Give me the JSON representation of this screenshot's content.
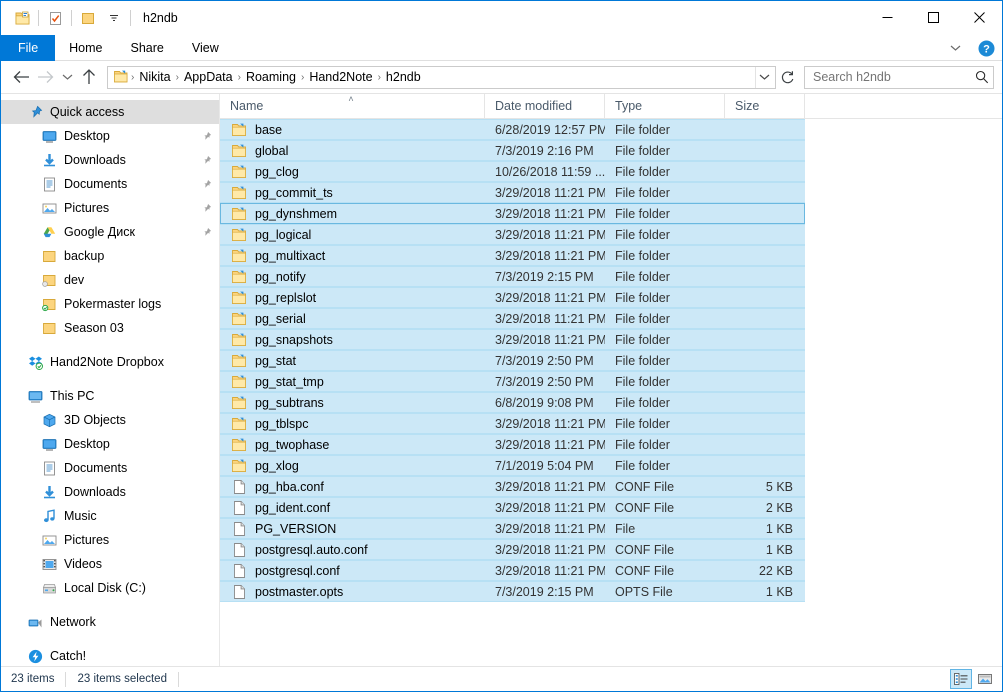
{
  "window": {
    "title": "h2ndb",
    "quick_access_toolbar": [
      {
        "name": "folder-properties-icon",
        "label": "Properties"
      },
      {
        "name": "new-folder-icon",
        "label": "New folder"
      },
      {
        "name": "customize-quick-access-icon",
        "label": "Customize Quick Access Toolbar"
      }
    ],
    "controls": {
      "minimize": "—",
      "maximize": "□",
      "close": "✕"
    }
  },
  "ribbon": {
    "tabs": [
      {
        "label": "File",
        "active": true
      },
      {
        "label": "Home",
        "active": false
      },
      {
        "label": "Share",
        "active": false
      },
      {
        "label": "View",
        "active": false
      }
    ],
    "collapse_label": "Minimize the Ribbon",
    "help_label": "Help"
  },
  "address": {
    "back_label": "Back",
    "forward_label": "Forward",
    "recent_label": "Recent locations",
    "up_label": "Up",
    "refresh_label": "Refresh",
    "dropdown_label": "Previous locations",
    "crumbs": [
      "Nikita",
      "AppData",
      "Roaming",
      "Hand2Note",
      "h2ndb"
    ],
    "separator": "›"
  },
  "search": {
    "placeholder": "Search h2ndb",
    "value": ""
  },
  "sidebar": {
    "groups": [
      {
        "items": [
          {
            "label": "Quick access",
            "icon": "quick-access-pin-icon",
            "indent": 0,
            "selected": true,
            "pinned": false
          },
          {
            "label": "Desktop",
            "icon": "desktop-icon",
            "indent": 1,
            "selected": false,
            "pinned": true
          },
          {
            "label": "Downloads",
            "icon": "downloads-icon",
            "indent": 1,
            "selected": false,
            "pinned": true
          },
          {
            "label": "Documents",
            "icon": "documents-icon",
            "indent": 1,
            "selected": false,
            "pinned": true
          },
          {
            "label": "Pictures",
            "icon": "pictures-icon",
            "indent": 1,
            "selected": false,
            "pinned": true
          },
          {
            "label": "Google Диск",
            "icon": "google-drive-icon",
            "indent": 1,
            "selected": false,
            "pinned": true
          },
          {
            "label": "backup",
            "icon": "folder-icon",
            "indent": 1,
            "selected": false,
            "pinned": false
          },
          {
            "label": "dev",
            "icon": "folder-sync-icon",
            "indent": 1,
            "selected": false,
            "pinned": false
          },
          {
            "label": "Pokermaster logs",
            "icon": "folder-synced-icon",
            "indent": 1,
            "selected": false,
            "pinned": false
          },
          {
            "label": "Season 03",
            "icon": "folder-icon",
            "indent": 1,
            "selected": false,
            "pinned": false
          }
        ]
      },
      {
        "items": [
          {
            "label": "Hand2Note Dropbox",
            "icon": "dropbox-icon",
            "indent": 0,
            "selected": false,
            "pinned": false
          }
        ]
      },
      {
        "items": [
          {
            "label": "This PC",
            "icon": "this-pc-icon",
            "indent": 0,
            "selected": false,
            "pinned": false
          },
          {
            "label": "3D Objects",
            "icon": "3d-objects-icon",
            "indent": 1,
            "selected": false,
            "pinned": false
          },
          {
            "label": "Desktop",
            "icon": "desktop-icon",
            "indent": 1,
            "selected": false,
            "pinned": false
          },
          {
            "label": "Documents",
            "icon": "documents-icon",
            "indent": 1,
            "selected": false,
            "pinned": false
          },
          {
            "label": "Downloads",
            "icon": "downloads-icon",
            "indent": 1,
            "selected": false,
            "pinned": false
          },
          {
            "label": "Music",
            "icon": "music-icon",
            "indent": 1,
            "selected": false,
            "pinned": false
          },
          {
            "label": "Pictures",
            "icon": "pictures-icon",
            "indent": 1,
            "selected": false,
            "pinned": false
          },
          {
            "label": "Videos",
            "icon": "videos-icon",
            "indent": 1,
            "selected": false,
            "pinned": false
          },
          {
            "label": "Local Disk (C:)",
            "icon": "hard-drive-icon",
            "indent": 1,
            "selected": false,
            "pinned": false
          }
        ]
      },
      {
        "items": [
          {
            "label": "Network",
            "icon": "network-icon",
            "indent": 0,
            "selected": false,
            "pinned": false
          }
        ]
      },
      {
        "items": [
          {
            "label": "Catch!",
            "icon": "catch-icon",
            "indent": 0,
            "selected": false,
            "pinned": false
          }
        ]
      }
    ]
  },
  "filelist": {
    "columns": [
      {
        "key": "name",
        "label": "Name",
        "sorted": "asc"
      },
      {
        "key": "date",
        "label": "Date modified",
        "sorted": ""
      },
      {
        "key": "type",
        "label": "Type",
        "sorted": ""
      },
      {
        "key": "size",
        "label": "Size",
        "sorted": ""
      }
    ],
    "sort_caret": "˄",
    "rows": [
      {
        "name": "base",
        "date": "6/28/2019 12:57 PM",
        "type": "File folder",
        "size": "",
        "icon": "folder-icon",
        "selected": true,
        "focus": false
      },
      {
        "name": "global",
        "date": "7/3/2019 2:16 PM",
        "type": "File folder",
        "size": "",
        "icon": "folder-icon",
        "selected": true,
        "focus": false
      },
      {
        "name": "pg_clog",
        "date": "10/26/2018 11:59 ...",
        "type": "File folder",
        "size": "",
        "icon": "folder-icon",
        "selected": true,
        "focus": false
      },
      {
        "name": "pg_commit_ts",
        "date": "3/29/2018 11:21 PM",
        "type": "File folder",
        "size": "",
        "icon": "folder-icon",
        "selected": true,
        "focus": false
      },
      {
        "name": "pg_dynshmem",
        "date": "3/29/2018 11:21 PM",
        "type": "File folder",
        "size": "",
        "icon": "folder-icon",
        "selected": true,
        "focus": true
      },
      {
        "name": "pg_logical",
        "date": "3/29/2018 11:21 PM",
        "type": "File folder",
        "size": "",
        "icon": "folder-icon",
        "selected": true,
        "focus": false
      },
      {
        "name": "pg_multixact",
        "date": "3/29/2018 11:21 PM",
        "type": "File folder",
        "size": "",
        "icon": "folder-icon",
        "selected": true,
        "focus": false
      },
      {
        "name": "pg_notify",
        "date": "7/3/2019 2:15 PM",
        "type": "File folder",
        "size": "",
        "icon": "folder-icon",
        "selected": true,
        "focus": false
      },
      {
        "name": "pg_replslot",
        "date": "3/29/2018 11:21 PM",
        "type": "File folder",
        "size": "",
        "icon": "folder-icon",
        "selected": true,
        "focus": false
      },
      {
        "name": "pg_serial",
        "date": "3/29/2018 11:21 PM",
        "type": "File folder",
        "size": "",
        "icon": "folder-icon",
        "selected": true,
        "focus": false
      },
      {
        "name": "pg_snapshots",
        "date": "3/29/2018 11:21 PM",
        "type": "File folder",
        "size": "",
        "icon": "folder-icon",
        "selected": true,
        "focus": false
      },
      {
        "name": "pg_stat",
        "date": "7/3/2019 2:50 PM",
        "type": "File folder",
        "size": "",
        "icon": "folder-icon",
        "selected": true,
        "focus": false
      },
      {
        "name": "pg_stat_tmp",
        "date": "7/3/2019 2:50 PM",
        "type": "File folder",
        "size": "",
        "icon": "folder-icon",
        "selected": true,
        "focus": false
      },
      {
        "name": "pg_subtrans",
        "date": "6/8/2019 9:08 PM",
        "type": "File folder",
        "size": "",
        "icon": "folder-icon",
        "selected": true,
        "focus": false
      },
      {
        "name": "pg_tblspc",
        "date": "3/29/2018 11:21 PM",
        "type": "File folder",
        "size": "",
        "icon": "folder-icon",
        "selected": true,
        "focus": false
      },
      {
        "name": "pg_twophase",
        "date": "3/29/2018 11:21 PM",
        "type": "File folder",
        "size": "",
        "icon": "folder-icon",
        "selected": true,
        "focus": false
      },
      {
        "name": "pg_xlog",
        "date": "7/1/2019 5:04 PM",
        "type": "File folder",
        "size": "",
        "icon": "folder-icon",
        "selected": true,
        "focus": false
      },
      {
        "name": "pg_hba.conf",
        "date": "3/29/2018 11:21 PM",
        "type": "CONF File",
        "size": "5 KB",
        "icon": "file-icon",
        "selected": true,
        "focus": false
      },
      {
        "name": "pg_ident.conf",
        "date": "3/29/2018 11:21 PM",
        "type": "CONF File",
        "size": "2 KB",
        "icon": "file-icon",
        "selected": true,
        "focus": false
      },
      {
        "name": "PG_VERSION",
        "date": "3/29/2018 11:21 PM",
        "type": "File",
        "size": "1 KB",
        "icon": "file-icon",
        "selected": true,
        "focus": false
      },
      {
        "name": "postgresql.auto.conf",
        "date": "3/29/2018 11:21 PM",
        "type": "CONF File",
        "size": "1 KB",
        "icon": "file-icon",
        "selected": true,
        "focus": false
      },
      {
        "name": "postgresql.conf",
        "date": "3/29/2018 11:21 PM",
        "type": "CONF File",
        "size": "22 KB",
        "icon": "file-icon",
        "selected": true,
        "focus": false
      },
      {
        "name": "postmaster.opts",
        "date": "7/3/2019 2:15 PM",
        "type": "OPTS File",
        "size": "1 KB",
        "icon": "file-icon",
        "selected": true,
        "focus": false
      }
    ]
  },
  "statusbar": {
    "item_count": "23 items",
    "selection_count": "23 items selected",
    "views": [
      {
        "name": "details-view",
        "label": "Details view",
        "active": true
      },
      {
        "name": "large-icons-view",
        "label": "Large icons view",
        "active": false
      }
    ]
  },
  "colors": {
    "accent": "#0078d7",
    "selection": "#cce8f7",
    "selection_border": "#b7e0f4",
    "focus_border": "#6ab8e0",
    "nav_selected": "#dedede",
    "folder_yellow": "#ffd06b"
  }
}
